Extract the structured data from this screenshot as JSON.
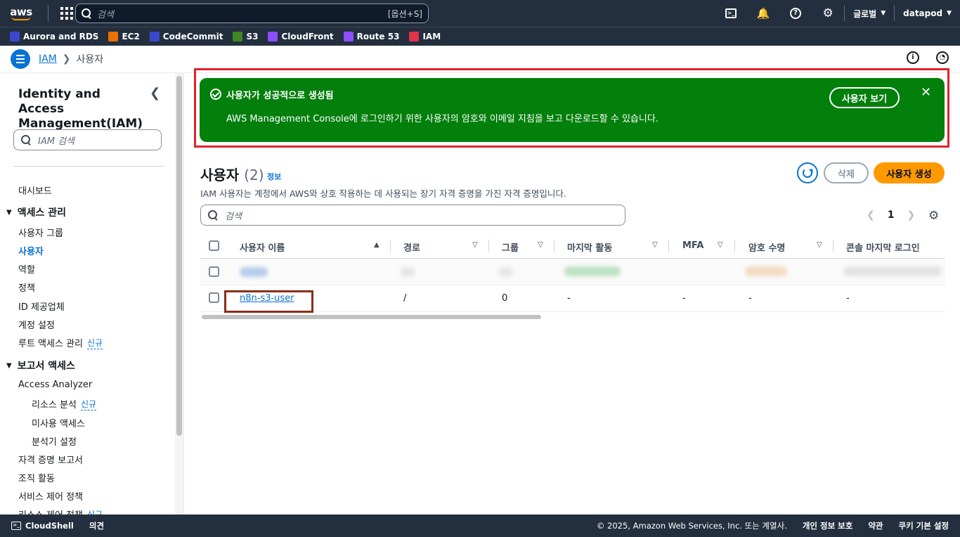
{
  "topnav": {
    "logo": "aws",
    "search_placeholder": "검색",
    "search_shortcut": "[옵션+S]",
    "region": "글로벌",
    "account": "datapod"
  },
  "favorites": [
    {
      "label": "Aurora and RDS",
      "color": "#3b48cc"
    },
    {
      "label": "EC2",
      "color": "#ed7100"
    },
    {
      "label": "CodeCommit",
      "color": "#3b48cc"
    },
    {
      "label": "S3",
      "color": "#3f8624"
    },
    {
      "label": "CloudFront",
      "color": "#8c4fff"
    },
    {
      "label": "Route 53",
      "color": "#8c4fff"
    },
    {
      "label": "IAM",
      "color": "#dd344c"
    }
  ],
  "breadcrumb": {
    "root": "IAM",
    "current": "사용자"
  },
  "sidebar": {
    "title": "Identity and Access Management(IAM)",
    "search_placeholder": "IAM 검색",
    "new_badge": "신규",
    "dashboard": "대시보드",
    "access_mgmt": "액세스 관리",
    "items": {
      "user_groups": "사용자 그룹",
      "users": "사용자",
      "roles": "역할",
      "policies": "정책",
      "id_providers": "ID 제공업체",
      "account_settings": "계정 설정",
      "root_access": "루트 액세스 관리"
    },
    "report_access": "보고서 액세스",
    "report_items": {
      "access_analyzer": "Access Analyzer",
      "resource_analysis": "리소스 분석",
      "unused_access": "미사용 액세스",
      "analyzer_settings": "분석기 설정",
      "credential_report": "자격 증명 보고서",
      "org_activity": "조직 활동",
      "scp": "서비스 제어 정책",
      "rcp": "리소스 제어 정책"
    }
  },
  "flash": {
    "title": "사용자가 성공적으로 생성됨",
    "description": "AWS Management Console에 로그인하기 위한 사용자의 암호와 이메일 지침을 보고 다운로드할 수 있습니다.",
    "view_button": "사용자 보기",
    "color": "#037f0c"
  },
  "header": {
    "title": "사용자",
    "count": "(2)",
    "info": "정보",
    "description": "IAM 사용자는 계정에서 AWS와 상호 작용하는 데 사용되는 장기 자격 증명을 가진 자격 증명입니다.",
    "delete_button": "삭제",
    "create_button": "사용자 생성"
  },
  "table": {
    "search_placeholder": "검색",
    "page": "1",
    "columns": [
      "사용자 이름",
      "경로",
      "그룹",
      "마지막 활동",
      "MFA",
      "암호 수명",
      "콘솔 마지막 로그인"
    ],
    "rows": [
      {
        "name": "n8n-s3-user",
        "path": "/",
        "groups": "0",
        "last_activity": "-",
        "mfa": "-",
        "password_age": "-",
        "console_login": "-"
      }
    ]
  },
  "footer": {
    "cloudshell": "CloudShell",
    "feedback": "의견",
    "copyright": "© 2025, Amazon Web Services, Inc. 또는 계열사.",
    "privacy": "개인 정보 보호",
    "terms": "약관",
    "cookies": "쿠키 기본 설정"
  }
}
